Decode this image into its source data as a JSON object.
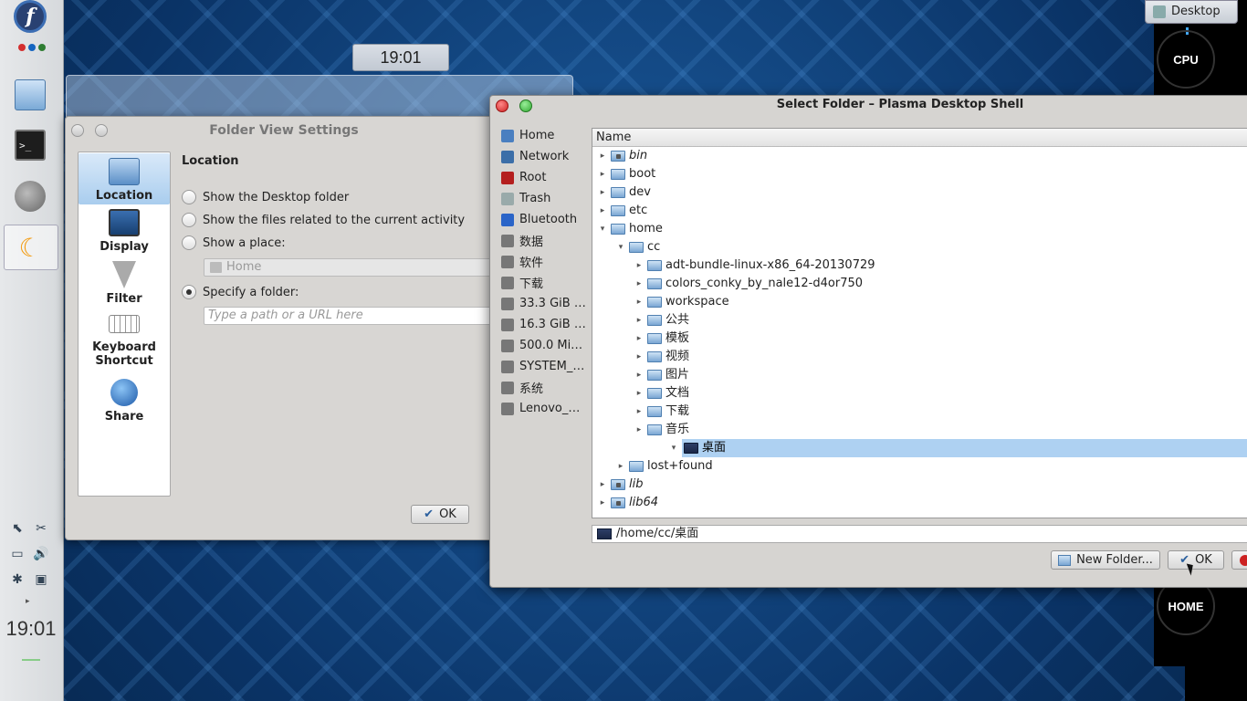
{
  "left_panel": {
    "clock": "19:01",
    "dot_colors": [
      "#d32f2f",
      "#1565c0",
      "#2e7d32"
    ]
  },
  "top_clock": "19:01",
  "desktop_tab": "Desktop",
  "gauges": {
    "cpu": "CPU",
    "home": "HOME"
  },
  "folder_view_settings": {
    "title": "Folder View Settings",
    "sidebar": [
      {
        "label": "Location",
        "selected": true
      },
      {
        "label": "Display"
      },
      {
        "label": "Filter"
      },
      {
        "label": "Keyboard Shortcut"
      },
      {
        "label": "Share"
      }
    ],
    "heading": "Location",
    "options": [
      {
        "label": "Show the Desktop folder",
        "checked": false
      },
      {
        "label": "Show the files related to the current activity",
        "checked": false
      },
      {
        "label": "Show a place:",
        "checked": false
      },
      {
        "label": "Specify a folder:",
        "checked": true
      }
    ],
    "place_value": "Home",
    "path_placeholder": "Type a path or a URL here",
    "ok_label": "OK"
  },
  "select_folder": {
    "title": "Select Folder – Plasma Desktop Shell",
    "places": [
      {
        "label": "Home",
        "icon": "home-icon",
        "color": "#4a7fc0"
      },
      {
        "label": "Network",
        "icon": "network-icon",
        "color": "#3b6ea8"
      },
      {
        "label": "Root",
        "icon": "root-folder-icon",
        "color": "#b41e1e"
      },
      {
        "label": "Trash",
        "icon": "trash-icon",
        "color": "#9aa"
      },
      {
        "label": "Bluetooth",
        "icon": "bluetooth-icon",
        "color": "#2a64c8"
      },
      {
        "label": "数据",
        "icon": "drive-icon",
        "color": "#777"
      },
      {
        "label": "软件",
        "icon": "drive-icon",
        "color": "#777"
      },
      {
        "label": "下载",
        "icon": "drive-icon",
        "color": "#777"
      },
      {
        "label": "33.3 GiB …",
        "icon": "drive-icon",
        "color": "#777"
      },
      {
        "label": "16.3 GiB …",
        "icon": "drive-icon",
        "color": "#777"
      },
      {
        "label": "500.0 Mi…",
        "icon": "drive-icon",
        "color": "#777"
      },
      {
        "label": "SYSTEM_…",
        "icon": "drive-icon",
        "color": "#777"
      },
      {
        "label": "系统",
        "icon": "drive-icon",
        "color": "#777"
      },
      {
        "label": "Lenovo_…",
        "icon": "drive-icon",
        "color": "#777"
      }
    ],
    "column_header": "Name",
    "tree": [
      {
        "label": "bin",
        "depth": 0,
        "exp": "▸",
        "italic": true,
        "kind": "sys"
      },
      {
        "label": "boot",
        "depth": 0,
        "exp": "▸"
      },
      {
        "label": "dev",
        "depth": 0,
        "exp": "▸"
      },
      {
        "label": "etc",
        "depth": 0,
        "exp": "▸"
      },
      {
        "label": "home",
        "depth": 0,
        "exp": "▾"
      },
      {
        "label": "cc",
        "depth": 1,
        "exp": "▾"
      },
      {
        "label": "adt-bundle-linux-x86_64-20130729",
        "depth": 2,
        "exp": "▸"
      },
      {
        "label": "colors_conky_by_nale12-d4or750",
        "depth": 2,
        "exp": "▸"
      },
      {
        "label": "workspace",
        "depth": 2,
        "exp": "▸"
      },
      {
        "label": "公共",
        "depth": 2,
        "exp": "▸"
      },
      {
        "label": "模板",
        "depth": 2,
        "exp": "▸"
      },
      {
        "label": "视频",
        "depth": 2,
        "exp": "▸"
      },
      {
        "label": "图片",
        "depth": 2,
        "exp": "▸"
      },
      {
        "label": "文档",
        "depth": 2,
        "exp": "▸"
      },
      {
        "label": "下载",
        "depth": 2,
        "exp": "▸"
      },
      {
        "label": "音乐",
        "depth": 2,
        "exp": "▸"
      },
      {
        "label": "桌面",
        "depth": 2,
        "exp": "▾",
        "selected": true,
        "kind": "desk"
      },
      {
        "label": "lost+found",
        "depth": 1,
        "exp": "▸"
      },
      {
        "label": "lib",
        "depth": 0,
        "exp": "▸",
        "italic": true,
        "kind": "sys"
      },
      {
        "label": "lib64",
        "depth": 0,
        "exp": "▸",
        "italic": true,
        "kind": "sys"
      }
    ],
    "path_value": "/home/cc/桌面",
    "new_folder_label": "New Folder...",
    "ok_label": "OK"
  }
}
